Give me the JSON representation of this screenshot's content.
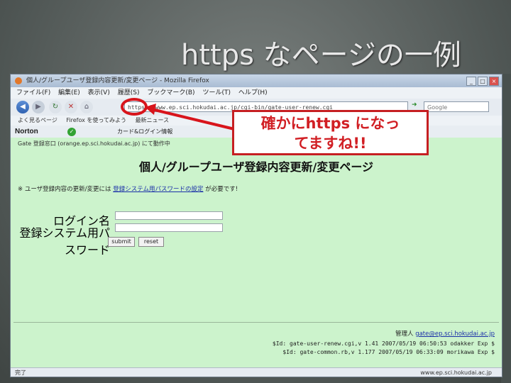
{
  "slide": {
    "title": "https なページの一例"
  },
  "browser": {
    "window_title": "個人/グループユーザ登録内容更新/変更ページ - Mozilla Firefox",
    "menu": [
      "ファイル(F)",
      "編集(E)",
      "表示(V)",
      "履歴(S)",
      "ブックマーク(B)",
      "ツール(T)",
      "ヘルプ(H)"
    ],
    "url": "https://www.ep.sci.hokudai.ac.jp/cgi-bin/gate-user-renew.cgi",
    "search_placeholder": "Google",
    "bookmarks": [
      "よく見るページ",
      "Firefox を使ってみよう",
      "最新ニュース"
    ],
    "norton": {
      "logo": "Norton",
      "card": "カード&ログイン情報"
    },
    "status_left": "完了",
    "status_right": "www.ep.sci.hokudai.ac.jp"
  },
  "page": {
    "notice": "Gate 登録窓口 (orange.ep.sci.hokudai.ac.jp) にて動作中",
    "heading": "個人/グループユーザ登録内容更新/変更ページ",
    "note_before": "※ ユーザ登録内容の更新/変更には",
    "note_link": "登録システム用パスワードの設定",
    "note_after": "が必要です!",
    "form": {
      "login_label": "ログイン名",
      "password_label": "登録システム用パスワード",
      "submit_label": "submit",
      "reset_label": "reset"
    },
    "admin_label": "管理人",
    "admin_link": "gate@ep.sci.hokudai.ac.jp",
    "version1": "$Id: gate-user-renew.cgi,v 1.41 2007/05/19 06:50:53 odakker Exp $",
    "version2": "$Id: gate-common.rb,v 1.177 2007/05/19 06:33:09 morikawa Exp $"
  },
  "annotation": {
    "callout_line1": "確かにhttps になっ",
    "callout_line2": "てますね!!",
    "color": "#d11f24"
  }
}
